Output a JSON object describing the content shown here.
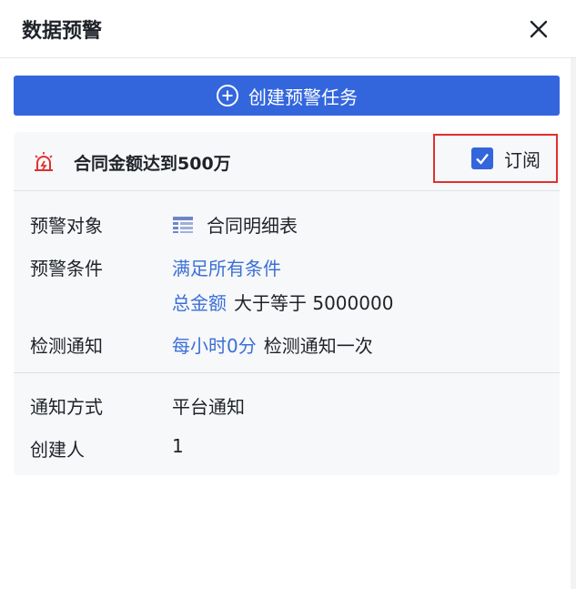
{
  "header": {
    "title": "数据预警"
  },
  "create_button": {
    "label": "创建预警任务"
  },
  "card": {
    "title": "合同金额达到500万",
    "subscribe": {
      "label": "订阅",
      "checked": true
    },
    "rows": {
      "target": {
        "label": "预警对象",
        "value": "合同明细表"
      },
      "condition": {
        "label": "预警条件",
        "mode": "满足所有条件",
        "field": "总金额",
        "rule": "大于等于 5000000"
      },
      "detect": {
        "label": "检测通知",
        "frequency": "每小时0分",
        "suffix": "检测通知一次"
      },
      "notify": {
        "label": "通知方式",
        "value": "平台通知"
      },
      "creator": {
        "label": "创建人",
        "value": "1"
      }
    }
  },
  "colors": {
    "primary": "#3366dd",
    "link": "#3b6fd6",
    "alert": "#e03030"
  },
  "icons": [
    "close-icon",
    "plus-circle-icon",
    "alarm-icon",
    "checkbox-checked-icon",
    "table-icon"
  ]
}
